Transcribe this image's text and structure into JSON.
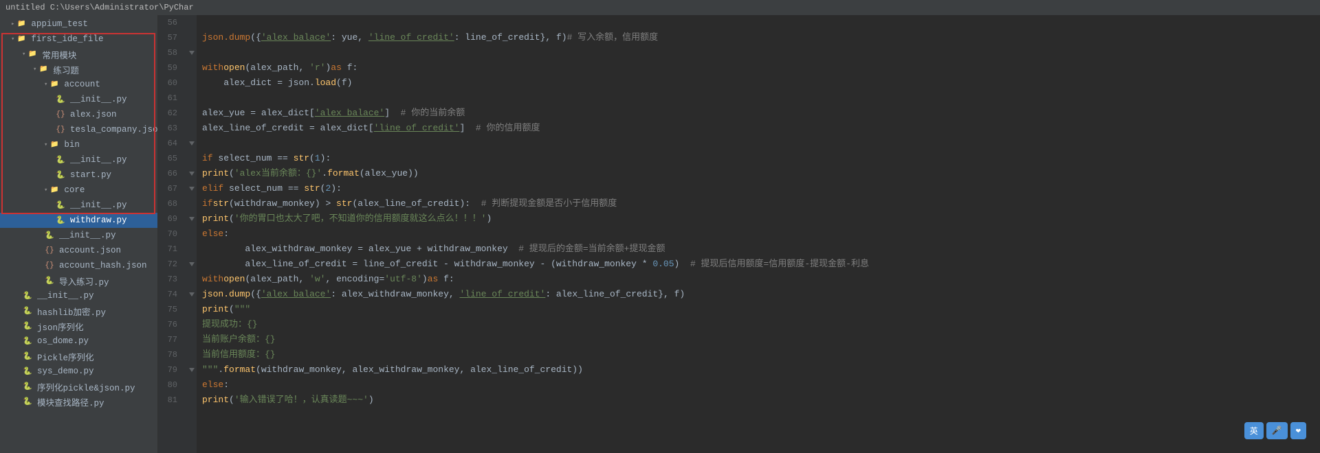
{
  "titleBar": {
    "text": "untitled  C:\\Users\\Administrator\\PyChar"
  },
  "sidebar": {
    "items": [
      {
        "id": "appium_test",
        "label": "appium_test",
        "indent": 1,
        "type": "folder",
        "expanded": false
      },
      {
        "id": "first_ide_file",
        "label": "first_ide_file",
        "indent": 1,
        "type": "folder",
        "expanded": true
      },
      {
        "id": "chang_mokuai",
        "label": "常用模块",
        "indent": 2,
        "type": "folder",
        "expanded": true
      },
      {
        "id": "lianxi_ti",
        "label": "练习题",
        "indent": 3,
        "type": "folder",
        "expanded": true
      },
      {
        "id": "account",
        "label": "account",
        "indent": 4,
        "type": "folder",
        "expanded": true
      },
      {
        "id": "init_py_acc",
        "label": "__init__.py",
        "indent": 5,
        "type": "py"
      },
      {
        "id": "alex_json",
        "label": "alex.json",
        "indent": 5,
        "type": "json"
      },
      {
        "id": "tesla_json",
        "label": "tesla_company.json",
        "indent": 5,
        "type": "json"
      },
      {
        "id": "bin",
        "label": "bin",
        "indent": 4,
        "type": "folder",
        "expanded": true
      },
      {
        "id": "init_py_bin",
        "label": "__init__.py",
        "indent": 5,
        "type": "py"
      },
      {
        "id": "start_py",
        "label": "start.py",
        "indent": 5,
        "type": "py"
      },
      {
        "id": "core",
        "label": "core",
        "indent": 4,
        "type": "folder",
        "expanded": true
      },
      {
        "id": "init_py_core",
        "label": "__init__.py",
        "indent": 5,
        "type": "py"
      },
      {
        "id": "withdraw_py",
        "label": "withdraw.py",
        "indent": 5,
        "type": "py",
        "selected": true
      },
      {
        "id": "init_py_lx",
        "label": "__init__.py",
        "indent": 4,
        "type": "py"
      },
      {
        "id": "account_json",
        "label": "account.json",
        "indent": 4,
        "type": "json"
      },
      {
        "id": "account_hash",
        "label": "account_hash.json",
        "indent": 4,
        "type": "json"
      },
      {
        "id": "daoru_lianxi",
        "label": "导入练习.py",
        "indent": 4,
        "type": "py"
      },
      {
        "id": "init_py_top",
        "label": "__init__.py",
        "indent": 2,
        "type": "py"
      },
      {
        "id": "hashlib_jiami",
        "label": "hashlib加密.py",
        "indent": 2,
        "type": "py"
      },
      {
        "id": "json_xulie",
        "label": "json序列化",
        "indent": 2,
        "type": "py"
      },
      {
        "id": "os_dome",
        "label": "os_dome.py",
        "indent": 2,
        "type": "py"
      },
      {
        "id": "pickle_xulie",
        "label": "Pickle序列化",
        "indent": 2,
        "type": "py"
      },
      {
        "id": "sys_demo",
        "label": "sys_demo.py",
        "indent": 2,
        "type": "py"
      },
      {
        "id": "xulie_pickle",
        "label": "序列化pickle&json.py",
        "indent": 2,
        "type": "py"
      },
      {
        "id": "mokuai_lujing",
        "label": "模块查找路径.py",
        "indent": 2,
        "type": "py"
      }
    ]
  },
  "editor": {
    "startLine": 57,
    "lines": [
      {
        "num": 57,
        "content": ""
      },
      {
        "num": 58,
        "content": "with open(alex_path, 'r')as f:"
      },
      {
        "num": 59,
        "content": "    alex_dict = json.load(f)"
      },
      {
        "num": 60,
        "content": ""
      },
      {
        "num": 61,
        "content": "alex_yue = alex_dict['alex_balace']   # 你的当前余额"
      },
      {
        "num": 62,
        "content": "alex_line_of_credit = alex_dict['line_of_credit']   # 你的信用额度"
      },
      {
        "num": 63,
        "content": ""
      },
      {
        "num": 64,
        "content": "if select_num == str(1):"
      },
      {
        "num": 65,
        "content": "    print('alex当前余额：{}'.format(alex_yue))"
      },
      {
        "num": 66,
        "content": "elif select_num == str(2):"
      },
      {
        "num": 67,
        "content": "    if str(withdraw_monkey) > str(alex_line_of_credit):   # 判断提现金额是否小于信用额度"
      },
      {
        "num": 68,
        "content": "        print('你的胃口也太大了吧，不知道你的信用额度就这么点么！！！')"
      },
      {
        "num": 69,
        "content": "    else:"
      },
      {
        "num": 70,
        "content": "        alex_withdraw_monkey = alex_yue + withdraw_monkey   # 提现后的金额=当前余额+提现金额"
      },
      {
        "num": 71,
        "content": "        alex_line_of_credit = line_of_credit - withdraw_monkey - (withdraw_monkey * 0.05)   # 提现后信用额度=信用额度-提现金额-利息"
      },
      {
        "num": 72,
        "content": "        with open(alex_path, 'w', encoding='utf-8')as f:"
      },
      {
        "num": 73,
        "content": "            json.dump({'alex_balace': alex_withdraw_monkey, 'line_of_credit': alex_line_of_credit}, f)"
      },
      {
        "num": 74,
        "content": "    print(\"\"\""
      },
      {
        "num": 75,
        "content": "        提现成功：{}"
      },
      {
        "num": 76,
        "content": "        当前账户余额：{}"
      },
      {
        "num": 77,
        "content": "        当前信用额度：{}"
      },
      {
        "num": 78,
        "content": "        \"\"\".format(withdraw_monkey, alex_withdraw_monkey, alex_line_of_credit))"
      },
      {
        "num": 79,
        "content": "else:"
      },
      {
        "num": 80,
        "content": "    print('输入错误了哈！，认真读题~~~')"
      }
    ]
  },
  "floatingWidget": {
    "label": "英 🎤 ❤"
  }
}
